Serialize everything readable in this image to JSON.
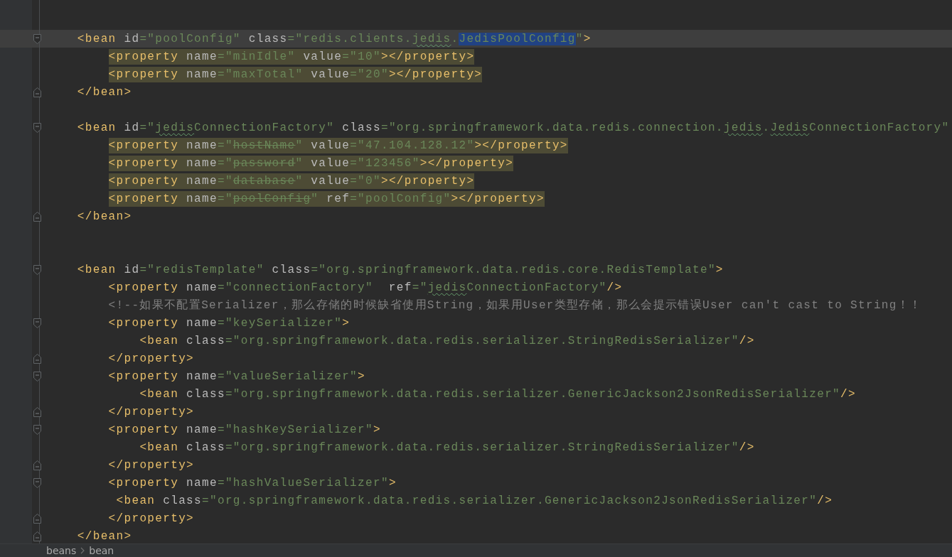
{
  "editor": {
    "lines": [
      {
        "kind": "plain",
        "current": false
      },
      {
        "kind": "opener",
        "current": true,
        "highlighted": false,
        "tokens": [
          {
            "kind": "tag",
            "text": "    <bean"
          },
          {
            "kind": "attr",
            "text": " id"
          },
          {
            "kind": "value",
            "text": "=\"poolConfig\""
          },
          {
            "kind": "attr",
            "text": " class"
          },
          {
            "kind": "value",
            "text": "=\"redis.clients."
          },
          {
            "kind": "value",
            "text": "jedis",
            "typo": true
          },
          {
            "kind": "value",
            "text": "."
          },
          {
            "kind": "value",
            "text": "JedisPoolConfig",
            "selected": true
          },
          {
            "kind": "value",
            "text": "\""
          },
          {
            "kind": "tag",
            "text": ">"
          }
        ]
      },
      {
        "kind": "plain",
        "current": false,
        "highlighted": true,
        "tokens": [
          {
            "kind": "tag",
            "text": "        <property"
          },
          {
            "kind": "attr",
            "text": " name"
          },
          {
            "kind": "value",
            "text": "=\"minIdle\""
          },
          {
            "kind": "attr",
            "text": " value"
          },
          {
            "kind": "value",
            "text": "=\"10\""
          },
          {
            "kind": "tag",
            "text": "></property>"
          }
        ]
      },
      {
        "kind": "plain",
        "current": false,
        "highlighted": true,
        "tokens": [
          {
            "kind": "tag",
            "text": "        <property"
          },
          {
            "kind": "attr",
            "text": " name"
          },
          {
            "kind": "value",
            "text": "=\"maxTotal\""
          },
          {
            "kind": "attr",
            "text": " value"
          },
          {
            "kind": "value",
            "text": "=\"20\""
          },
          {
            "kind": "tag",
            "text": "></property>"
          }
        ]
      },
      {
        "kind": "closer",
        "current": false,
        "highlighted": false,
        "tokens": [
          {
            "kind": "tag",
            "text": "    </bean>"
          }
        ]
      },
      {
        "kind": "plain",
        "current": false
      },
      {
        "kind": "opener",
        "current": false,
        "highlighted": false,
        "tokens": [
          {
            "kind": "tag",
            "text": "    <bean"
          },
          {
            "kind": "attr",
            "text": " id"
          },
          {
            "kind": "value",
            "text": "=\""
          },
          {
            "kind": "value",
            "text": "jedis",
            "typo": true
          },
          {
            "kind": "value",
            "text": "ConnectionFactory\""
          },
          {
            "kind": "attr",
            "text": " class"
          },
          {
            "kind": "value",
            "text": "=\"org.springframework.data.redis.connection."
          },
          {
            "kind": "value",
            "text": "jedis",
            "typo": true
          },
          {
            "kind": "value",
            "text": "."
          },
          {
            "kind": "value",
            "text": "Jedis",
            "typo": true
          },
          {
            "kind": "value",
            "text": "ConnectionFactory\""
          }
        ]
      },
      {
        "kind": "plain",
        "current": false,
        "highlighted": true,
        "tokens": [
          {
            "kind": "tag",
            "text": "        <property"
          },
          {
            "kind": "attr",
            "text": " name"
          },
          {
            "kind": "value",
            "text": "=\""
          },
          {
            "kind": "value",
            "text": "hostName",
            "strike": true
          },
          {
            "kind": "value",
            "text": "\""
          },
          {
            "kind": "attr",
            "text": " value"
          },
          {
            "kind": "value",
            "text": "=\"47.104.128.12\""
          },
          {
            "kind": "tag",
            "text": "></property>"
          }
        ]
      },
      {
        "kind": "plain",
        "current": false,
        "highlighted": true,
        "tokens": [
          {
            "kind": "tag",
            "text": "        <property"
          },
          {
            "kind": "attr",
            "text": " name"
          },
          {
            "kind": "value",
            "text": "=\""
          },
          {
            "kind": "value",
            "text": "password",
            "strike": true
          },
          {
            "kind": "value",
            "text": "\""
          },
          {
            "kind": "attr",
            "text": " value"
          },
          {
            "kind": "value",
            "text": "=\"123456\""
          },
          {
            "kind": "tag",
            "text": "></property>"
          }
        ]
      },
      {
        "kind": "plain",
        "current": false,
        "highlighted": true,
        "tokens": [
          {
            "kind": "tag",
            "text": "        <property"
          },
          {
            "kind": "attr",
            "text": " name"
          },
          {
            "kind": "value",
            "text": "=\""
          },
          {
            "kind": "value",
            "text": "database",
            "strike": true
          },
          {
            "kind": "value",
            "text": "\""
          },
          {
            "kind": "attr",
            "text": " value"
          },
          {
            "kind": "value",
            "text": "=\"0\""
          },
          {
            "kind": "tag",
            "text": "></property>"
          }
        ]
      },
      {
        "kind": "plain",
        "current": false,
        "highlighted": true,
        "tokens": [
          {
            "kind": "tag",
            "text": "        <property"
          },
          {
            "kind": "attr",
            "text": " name"
          },
          {
            "kind": "value",
            "text": "=\""
          },
          {
            "kind": "value",
            "text": "poolConfig",
            "strike": true
          },
          {
            "kind": "value",
            "text": "\""
          },
          {
            "kind": "attr",
            "text": " ref"
          },
          {
            "kind": "value",
            "text": "=\"poolConfig\""
          },
          {
            "kind": "tag",
            "text": "></property>"
          }
        ]
      },
      {
        "kind": "closer",
        "current": false,
        "highlighted": false,
        "tokens": [
          {
            "kind": "tag",
            "text": "    </bean>"
          }
        ]
      },
      {
        "kind": "plain",
        "current": false
      },
      {
        "kind": "plain",
        "current": false
      },
      {
        "kind": "opener",
        "current": false,
        "highlighted": false,
        "tokens": [
          {
            "kind": "tag",
            "text": "    <bean"
          },
          {
            "kind": "attr",
            "text": " id"
          },
          {
            "kind": "value",
            "text": "=\"redisTemplate\""
          },
          {
            "kind": "attr",
            "text": " class"
          },
          {
            "kind": "value",
            "text": "=\"org.springframework.data.redis.core.RedisTemplate\""
          },
          {
            "kind": "tag",
            "text": ">"
          }
        ]
      },
      {
        "kind": "plain",
        "current": false,
        "highlighted": false,
        "tokens": [
          {
            "kind": "tag",
            "text": "        <property"
          },
          {
            "kind": "attr",
            "text": " name"
          },
          {
            "kind": "value",
            "text": "=\"connectionFactory\""
          },
          {
            "kind": "attr",
            "text": "  ref"
          },
          {
            "kind": "value",
            "text": "=\""
          },
          {
            "kind": "value",
            "text": "jedis",
            "typo": true
          },
          {
            "kind": "value",
            "text": "ConnectionFactory\""
          },
          {
            "kind": "tag",
            "text": "/>"
          }
        ]
      },
      {
        "kind": "plain",
        "current": false,
        "highlighted": false,
        "tokens": [
          {
            "kind": "comment",
            "text": "        <!--如果不配置Serializer，那么存储的时候缺省使用String，如果用User类型存储，那么会提示错误User can't cast to String！！"
          }
        ]
      },
      {
        "kind": "opener",
        "current": false,
        "highlighted": false,
        "tokens": [
          {
            "kind": "tag",
            "text": "        <property"
          },
          {
            "kind": "attr",
            "text": " name"
          },
          {
            "kind": "value",
            "text": "=\"keySerializer\""
          },
          {
            "kind": "tag",
            "text": ">"
          }
        ]
      },
      {
        "kind": "plain",
        "current": false,
        "highlighted": false,
        "tokens": [
          {
            "kind": "tag",
            "text": "            <bean"
          },
          {
            "kind": "attr",
            "text": " class"
          },
          {
            "kind": "value",
            "text": "=\"org.springframework.data.redis.serializer.StringRedisSerializer\""
          },
          {
            "kind": "tag",
            "text": "/>"
          }
        ]
      },
      {
        "kind": "closer",
        "current": false,
        "highlighted": false,
        "tokens": [
          {
            "kind": "tag",
            "text": "        </property>"
          }
        ]
      },
      {
        "kind": "opener",
        "current": false,
        "highlighted": false,
        "tokens": [
          {
            "kind": "tag",
            "text": "        <property"
          },
          {
            "kind": "attr",
            "text": " name"
          },
          {
            "kind": "value",
            "text": "=\"valueSerializer\""
          },
          {
            "kind": "tag",
            "text": ">"
          }
        ]
      },
      {
        "kind": "plain",
        "current": false,
        "highlighted": false,
        "tokens": [
          {
            "kind": "tag",
            "text": "            <bean"
          },
          {
            "kind": "attr",
            "text": " class"
          },
          {
            "kind": "value",
            "text": "=\"org.springframework.data.redis.serializer.GenericJackson2JsonRedisSerializer\""
          },
          {
            "kind": "tag",
            "text": "/>"
          }
        ]
      },
      {
        "kind": "closer",
        "current": false,
        "highlighted": false,
        "tokens": [
          {
            "kind": "tag",
            "text": "        </property>"
          }
        ]
      },
      {
        "kind": "opener",
        "current": false,
        "highlighted": false,
        "tokens": [
          {
            "kind": "tag",
            "text": "        <property"
          },
          {
            "kind": "attr",
            "text": " name"
          },
          {
            "kind": "value",
            "text": "=\"hashKeySerializer\""
          },
          {
            "kind": "tag",
            "text": ">"
          }
        ]
      },
      {
        "kind": "plain",
        "current": false,
        "highlighted": false,
        "tokens": [
          {
            "kind": "tag",
            "text": "            <bean"
          },
          {
            "kind": "attr",
            "text": " class"
          },
          {
            "kind": "value",
            "text": "=\"org.springframework.data.redis.serializer.StringRedisSerializer\""
          },
          {
            "kind": "tag",
            "text": "/>"
          }
        ]
      },
      {
        "kind": "closer",
        "current": false,
        "highlighted": false,
        "tokens": [
          {
            "kind": "tag",
            "text": "        </property>"
          }
        ]
      },
      {
        "kind": "opener",
        "current": false,
        "highlighted": false,
        "tokens": [
          {
            "kind": "tag",
            "text": "        <property"
          },
          {
            "kind": "attr",
            "text": " name"
          },
          {
            "kind": "value",
            "text": "=\"hashValueSerializer\""
          },
          {
            "kind": "tag",
            "text": ">"
          }
        ]
      },
      {
        "kind": "plain",
        "current": false,
        "highlighted": false,
        "tokens": [
          {
            "kind": "tag",
            "text": "         <bean"
          },
          {
            "kind": "attr",
            "text": " class"
          },
          {
            "kind": "value",
            "text": "=\"org.springframework.data.redis.serializer.GenericJackson2JsonRedisSerializer\""
          },
          {
            "kind": "tag",
            "text": "/>"
          }
        ]
      },
      {
        "kind": "closer",
        "current": false,
        "highlighted": false,
        "tokens": [
          {
            "kind": "tag",
            "text": "        </property>"
          }
        ]
      },
      {
        "kind": "closer",
        "current": false,
        "highlighted": false,
        "tokens": [
          {
            "kind": "tag",
            "text": "    </bean>"
          }
        ]
      }
    ]
  },
  "breadcrumbs": [
    "beans",
    "bean"
  ]
}
